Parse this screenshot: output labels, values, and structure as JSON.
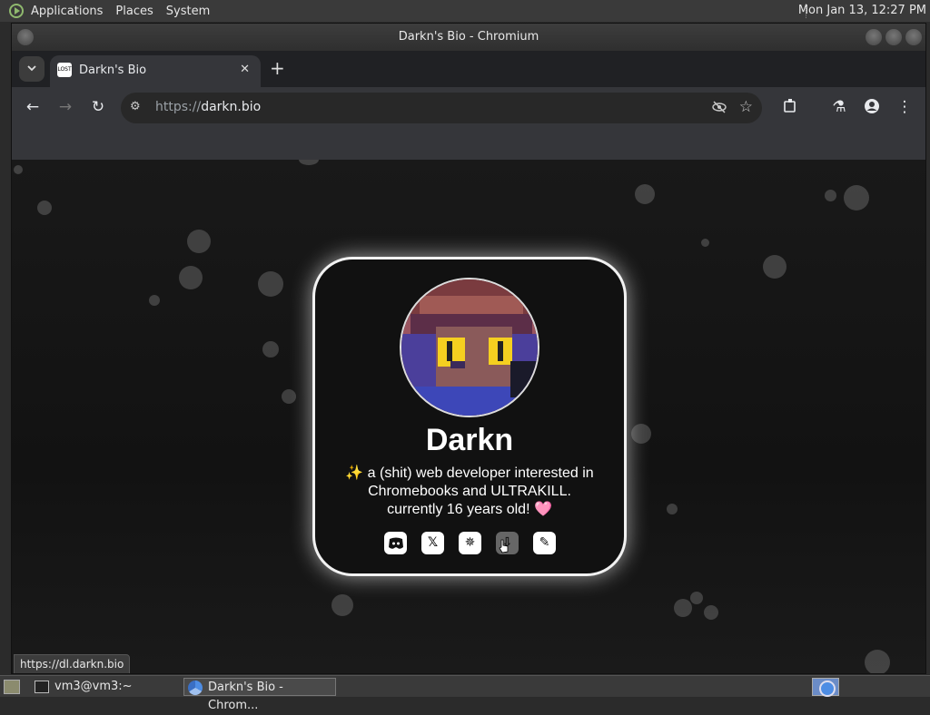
{
  "top_panel": {
    "menus": [
      "Applications",
      "Places",
      "System"
    ],
    "clock": "Mon Jan 13, 12:27 PM"
  },
  "window": {
    "title": "Darkn's Bio - Chromium"
  },
  "browser": {
    "tab_title": "Darkn's Bio",
    "favicon_text": "LOST",
    "url_scheme": "https://",
    "url_host": "darkn.bio",
    "status_url": "https://dl.darkn.bio"
  },
  "profile": {
    "name": "Darkn",
    "bio_line1": "✨ a (shit) web developer interested in",
    "bio_line2": "Chromebooks and ULTRAKILL.",
    "bio_line3": "currently 16 years old! 🩷",
    "links": [
      "discord-icon",
      "x-icon",
      "compass-icon",
      "download-icon",
      "edit-icon"
    ]
  },
  "taskbar": {
    "items": [
      "vm3@vm3:~",
      "Darkn's Bio - Chrom..."
    ]
  }
}
